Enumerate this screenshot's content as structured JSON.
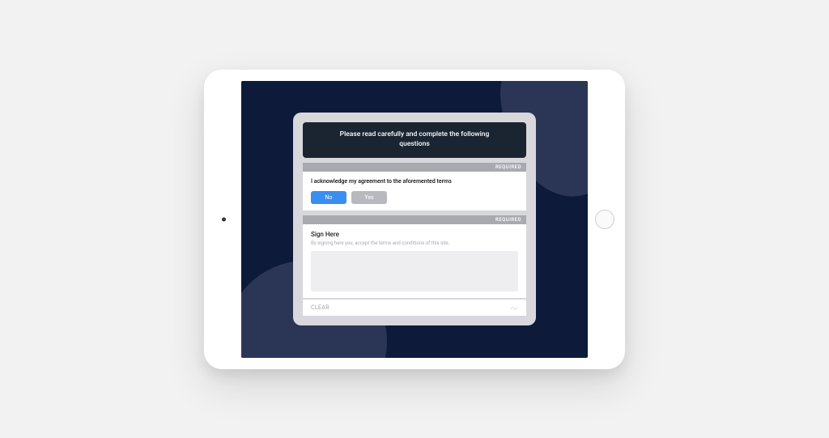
{
  "modal": {
    "header": "Please read carefully and complete the following questions"
  },
  "question1": {
    "required_label": "REQUIRED",
    "prompt": "I acknowledge my agreement to the aforemented terms",
    "option_no": "No",
    "option_yes": "Yes"
  },
  "signature": {
    "required_label": "REQUIRED",
    "title": "Sign Here",
    "hint": "By signing here you, accept the terms and conditions of this site.",
    "clear_label": "CLEAR"
  }
}
